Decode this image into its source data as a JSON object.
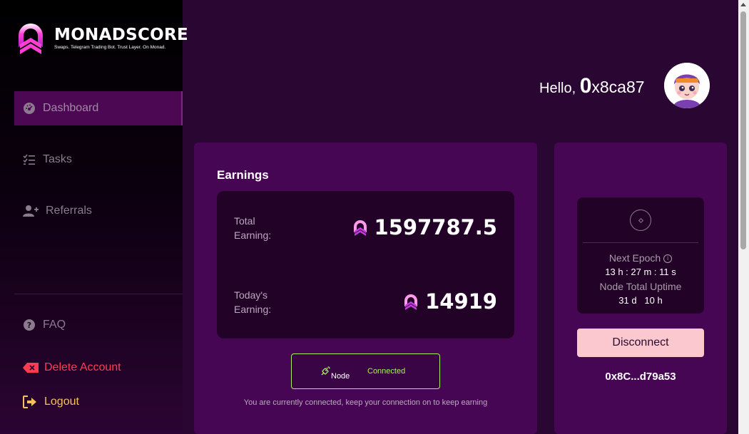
{
  "brand": {
    "name": "MONADSCORE",
    "tagline": "Swaps. Telegram Trading Bot. Trust Layer. On Monad.",
    "colors": {
      "pink": "#ff3fd4",
      "purple": "#b63ae0"
    }
  },
  "sidebar": {
    "items": [
      {
        "label": "Dashboard",
        "icon": "gauge-icon",
        "active": true
      },
      {
        "label": "Tasks",
        "icon": "checklist-icon",
        "active": false
      },
      {
        "label": "Referrals",
        "icon": "user-plus-icon",
        "active": false
      }
    ],
    "faq": {
      "label": "FAQ",
      "icon": "question-circle-icon"
    },
    "delete_account": {
      "label": "Delete Account",
      "icon": "delete-tag-icon",
      "color": "#ff3b52"
    },
    "logout": {
      "label": "Logout",
      "icon": "logout-icon",
      "color": "#f7c25a"
    }
  },
  "header": {
    "greeting": "Hello,",
    "address_lead": "0",
    "address_rest": "x8ca87",
    "avatar": "user-avatar"
  },
  "earnings": {
    "title": "Earnings",
    "total_label": "Total Earning:",
    "total_value": "1597787.5",
    "today_label": "Today's Earning:",
    "today_value": "14919",
    "token_icon": "monad-token-icon"
  },
  "node": {
    "label": "Node",
    "status": "Connected",
    "status_color": "#a6f15a",
    "message": "You are currently connected, keep your connection on to keep earning"
  },
  "epoch": {
    "next_epoch_label": "Next Epoch",
    "countdown": "13 h : 27 m : 11 s",
    "uptime_label": "Node Total Uptime",
    "uptime": "31 d   10 h",
    "disconnect_label": "Disconnect",
    "wallet": "0x8C...d79a53"
  }
}
